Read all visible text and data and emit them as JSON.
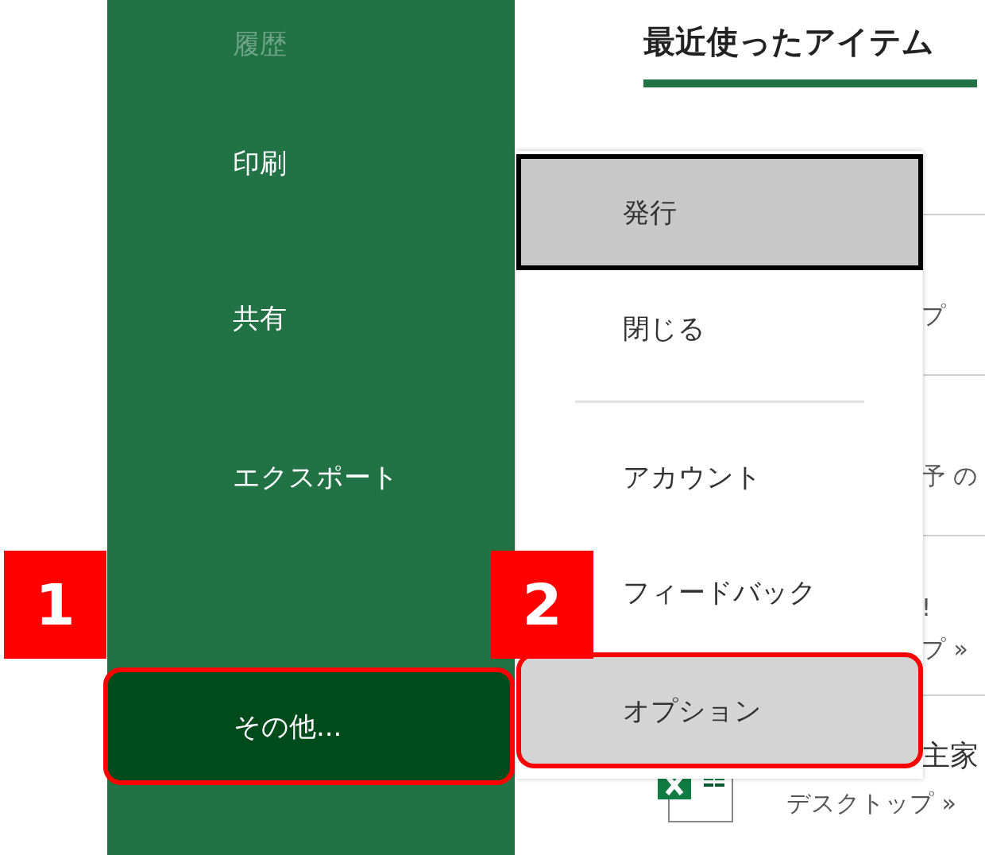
{
  "sidebar": {
    "items": [
      {
        "label": "履歴",
        "selected": false,
        "disabled": true,
        "annotated": false
      },
      {
        "label": "印刷",
        "selected": false,
        "disabled": false,
        "annotated": false
      },
      {
        "label": "共有",
        "selected": false,
        "disabled": false,
        "annotated": false
      },
      {
        "label": "エクスポート",
        "selected": false,
        "disabled": false,
        "annotated": false
      },
      {
        "label": "その他...",
        "selected": true,
        "disabled": false,
        "annotated": true
      }
    ]
  },
  "main": {
    "tab": {
      "label": "最近使ったアイテム",
      "selected": true
    },
    "recent_rows": [
      {
        "kind": "text",
        "lines": [
          "プ"
        ]
      },
      {
        "kind": "text",
        "lines": [
          "予 の"
        ]
      },
      {
        "kind": "text",
        "lines": [
          "!",
          "プ »"
        ]
      },
      {
        "kind": "excel",
        "lines": [
          "主家",
          "デスクトップ »"
        ]
      }
    ]
  },
  "more_menu": {
    "items": [
      {
        "kind": "item",
        "label": "発行",
        "highlighted": true,
        "focused": true,
        "annotated": false
      },
      {
        "kind": "item",
        "label": "閉じる",
        "highlighted": false,
        "focused": false,
        "annotated": false
      },
      {
        "kind": "divider"
      },
      {
        "kind": "item",
        "label": "アカウント",
        "highlighted": false,
        "focused": false,
        "annotated": false
      },
      {
        "kind": "item",
        "label": "フィードバック",
        "highlighted": false,
        "focused": false,
        "annotated": false
      },
      {
        "kind": "item",
        "label": "オプション",
        "highlighted": true,
        "focused": false,
        "annotated": true
      }
    ]
  },
  "annotations": [
    {
      "label": "1"
    },
    {
      "label": "2"
    }
  ]
}
